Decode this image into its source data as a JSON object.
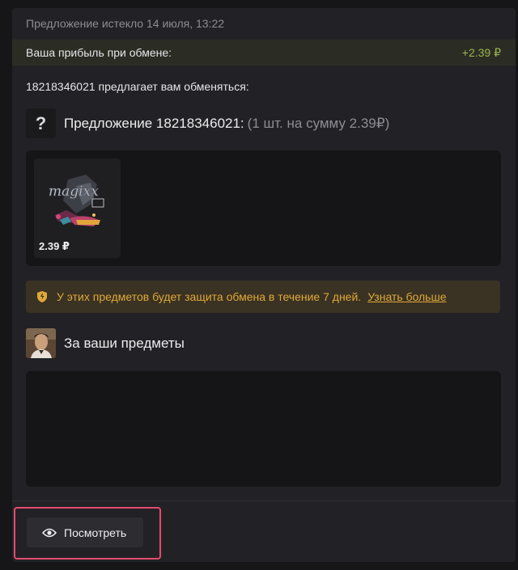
{
  "header": {
    "expired_text": "Предложение истекло 14 июля, 13:22"
  },
  "profit": {
    "label": "Ваша прибыль при обмене:",
    "value": "+2.39 ₽",
    "value_color": "#9bb54a"
  },
  "offer": {
    "intro": "18218346021 предлагает вам обменяться:",
    "avatar_glyph": "?",
    "title": "Предложение 18218346021:",
    "count_text": "(1 шт. на сумму 2.39₽)",
    "items": [
      {
        "image_icon": "magixx-sticker-icon",
        "price": "2.39 ₽"
      }
    ]
  },
  "protection": {
    "text": "У этих предметов будет защита обмена в течение 7 дней.",
    "link": "Узнать больше",
    "color": "#e0a93a"
  },
  "yours": {
    "title": "За ваши предметы",
    "avatar_icon": "user-avatar"
  },
  "actions": {
    "view_label": "Посмотреть",
    "view_icon": "eye-icon",
    "highlight_color": "#e64a6e"
  }
}
